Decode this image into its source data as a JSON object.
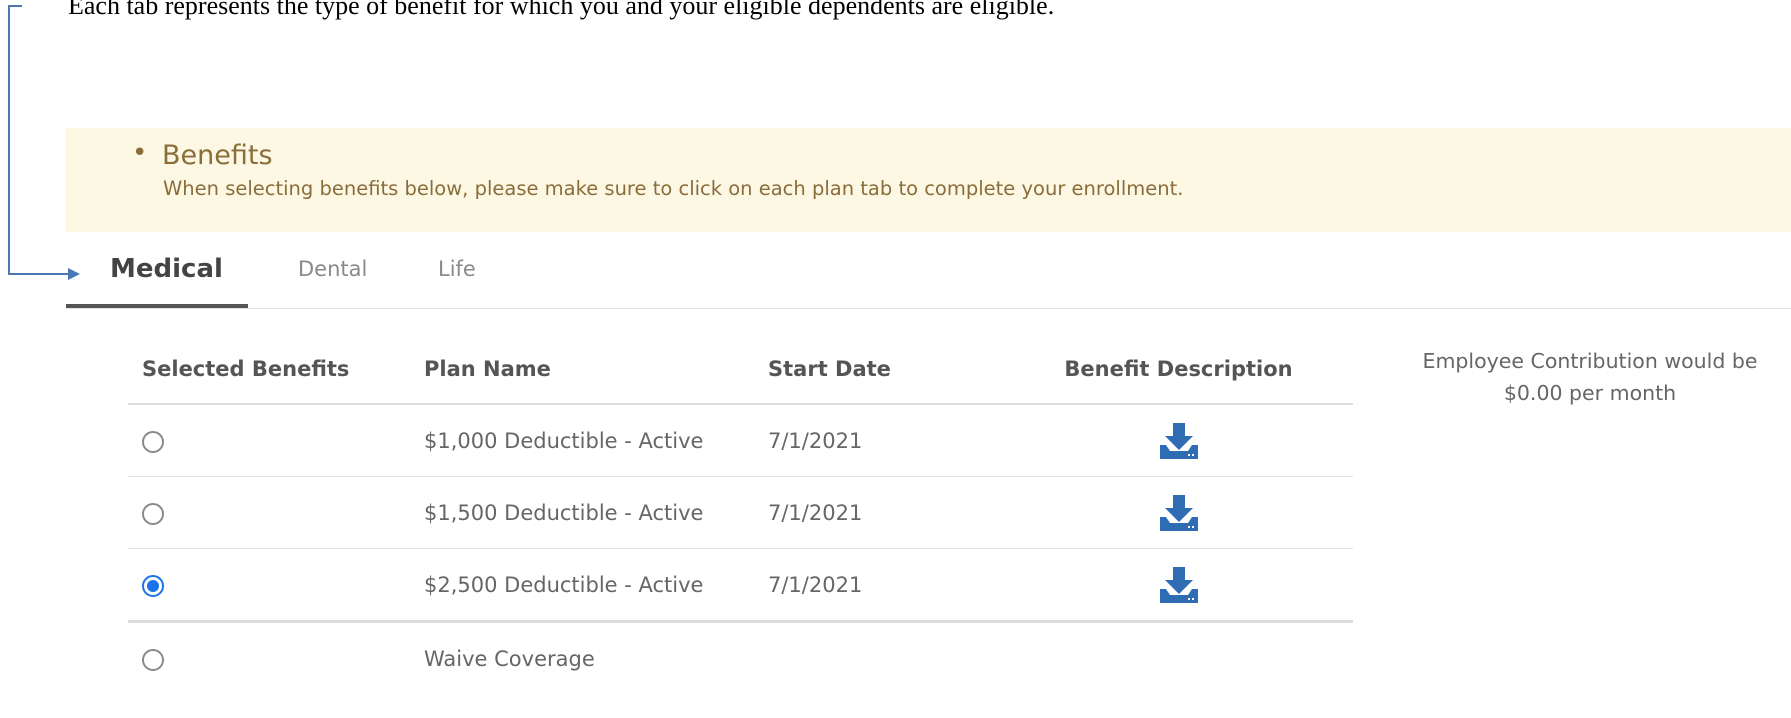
{
  "caption": "Each tab represents the type of benefit for which you and your eligible dependents are eligible.",
  "banner": {
    "bullet": "•",
    "title": "Benefits",
    "description": "When selecting benefits below, please make sure to click on each plan tab to complete your enrollment."
  },
  "tabs": [
    {
      "label": "Medical",
      "active": true
    },
    {
      "label": "Dental",
      "active": false
    },
    {
      "label": "Life",
      "active": false
    }
  ],
  "table": {
    "headers": [
      "Selected Benefits",
      "Plan Name",
      "Start Date",
      "Benefit Description"
    ],
    "rows": [
      {
        "plan_name": "$1,000 Deductible - Active",
        "start_date": "7/1/2021",
        "selected": false,
        "icon": "download-icon"
      },
      {
        "plan_name": "$1,500 Deductible - Active",
        "start_date": "7/1/2021",
        "selected": false,
        "icon": "download-icon"
      },
      {
        "plan_name": "$2,500 Deductible - Active",
        "start_date": "7/1/2021",
        "selected": true,
        "icon": "download-icon"
      },
      {
        "plan_name": "Waive Coverage",
        "start_date": "",
        "selected": false,
        "icon": ""
      }
    ]
  },
  "contribution": {
    "line1": "Employee Contribution would be",
    "line2": "$0.00 per month"
  },
  "colors": {
    "accent": "#1a73e8",
    "icon_blue": "#2e6db4",
    "banner_bg": "#fdf8e4",
    "banner_text": "#8a6d3b",
    "callout": "#4a78b5"
  }
}
